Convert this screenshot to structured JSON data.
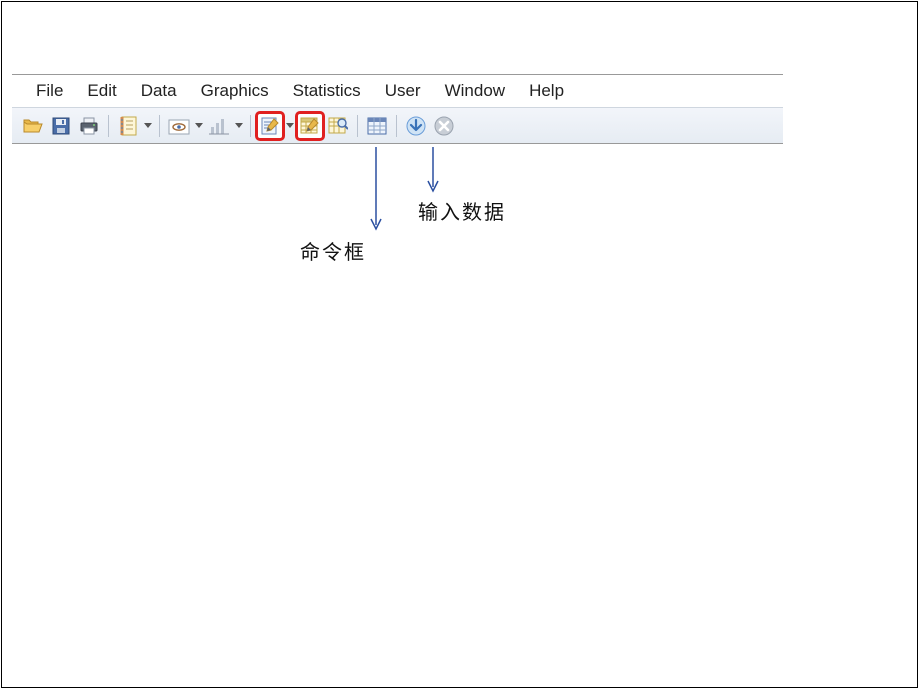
{
  "menubar": {
    "items": [
      "File",
      "Edit",
      "Data",
      "Graphics",
      "Statistics",
      "User",
      "Window",
      "Help"
    ]
  },
  "toolbar": {
    "open": "Open",
    "save": "Save",
    "print": "Print",
    "log": "Log",
    "viewer": "Viewer",
    "graph": "Graph",
    "dofile_editor": "Do-file Editor",
    "data_editor": "Data Editor",
    "data_browser": "Data Browser",
    "variables": "Variables Manager",
    "go": "Go",
    "break": "Break"
  },
  "annotations": {
    "command_box": "命令框",
    "input_data": "输入数据"
  }
}
